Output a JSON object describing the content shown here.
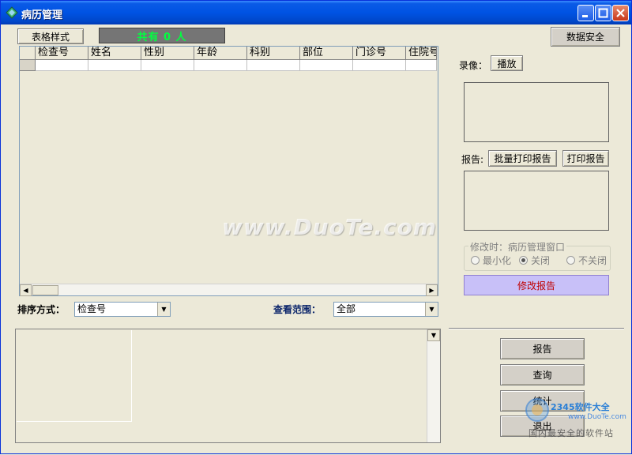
{
  "window": {
    "title": "病历管理",
    "colors": {
      "titlebar": "#0053e3",
      "count_text": "#00ff40",
      "edit_report_bg": "#c8c0f8",
      "edit_report_text": "#c00000"
    }
  },
  "toolbar": {
    "table_style_button": "表格样式",
    "count_display": "共有 0 人",
    "data_security_button": "数据安全"
  },
  "grid": {
    "columns": [
      "检查号",
      "姓名",
      "性别",
      "年龄",
      "科别",
      "部位",
      "门诊号",
      "住院号"
    ]
  },
  "sort": {
    "label": "排序方式：",
    "selected": "检查号"
  },
  "view_range": {
    "label": "查看范围：",
    "selected": "全部"
  },
  "side": {
    "video_label": "录像：",
    "play_button": "播放",
    "report_label": "报告:",
    "batch_print_button": "批量打印报告",
    "print_button": "打印报告",
    "modify_group_title": "修改时：病历管理窗口",
    "radio_minimize": "最小化",
    "radio_close": "关闭",
    "radio_not_close": "不关闭",
    "radio_selected": "关闭",
    "edit_report_button": "修改报告"
  },
  "actions": {
    "report": "报告",
    "query": "查询",
    "statistics": "统计",
    "exit": "退出"
  },
  "watermarks": {
    "duote": "www.DuoTe.com",
    "brand": "2345软件大全",
    "site": "www.DuoTe.com",
    "slogan": "国内最安全的软件站"
  }
}
